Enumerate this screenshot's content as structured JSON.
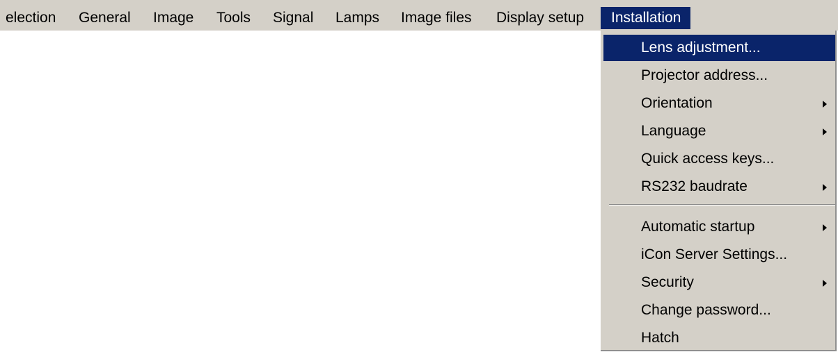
{
  "menubar": {
    "items": [
      {
        "label": "election"
      },
      {
        "label": "General"
      },
      {
        "label": "Image"
      },
      {
        "label": "Tools"
      },
      {
        "label": "Signal"
      },
      {
        "label": "Lamps"
      },
      {
        "label": "Image files"
      },
      {
        "label": "Display setup"
      },
      {
        "label": "Installation",
        "active": true
      }
    ]
  },
  "dropdown": {
    "items": [
      {
        "label": "Lens adjustment...",
        "highlighted": true,
        "submenu": false
      },
      {
        "label": "Projector address...",
        "submenu": false
      },
      {
        "label": "Orientation",
        "submenu": true
      },
      {
        "label": "Language",
        "submenu": true
      },
      {
        "label": "Quick access keys...",
        "submenu": false
      },
      {
        "label": "RS232 baudrate",
        "submenu": true
      },
      {
        "label": "Automatic startup",
        "submenu": true
      },
      {
        "label": "iCon Server Settings...",
        "submenu": false
      },
      {
        "label": "Security",
        "submenu": true
      },
      {
        "label": "Change password...",
        "submenu": false
      },
      {
        "label": "Hatch",
        "submenu": false
      }
    ]
  },
  "colors": {
    "menu_background": "#d4d0c8",
    "highlight": "#0a246a",
    "highlight_text": "#ffffff"
  }
}
